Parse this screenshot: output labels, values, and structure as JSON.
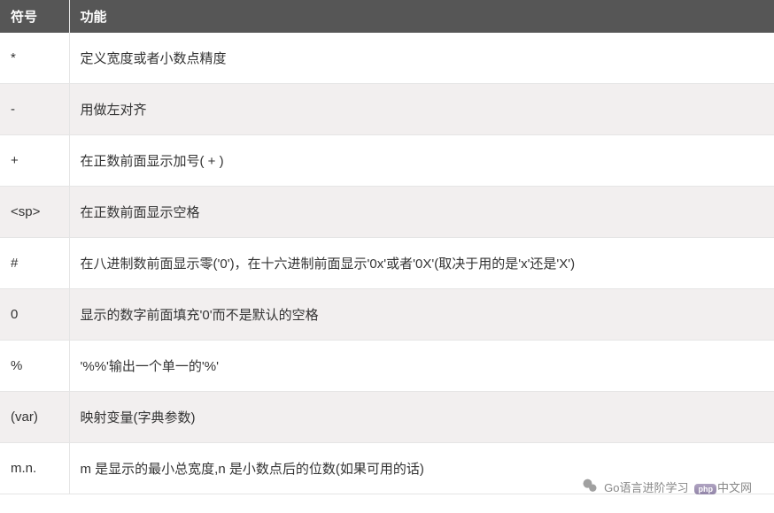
{
  "table": {
    "headers": {
      "symbol": "符号",
      "function": "功能"
    },
    "rows": [
      {
        "symbol": "*",
        "desc": "定义宽度或者小数点精度"
      },
      {
        "symbol": "-",
        "desc": "用做左对齐"
      },
      {
        "symbol": "+",
        "desc": "在正数前面显示加号( + )"
      },
      {
        "symbol": "<sp>",
        "desc": "在正数前面显示空格"
      },
      {
        "symbol": "#",
        "desc": "在八进制数前面显示零('0')，在十六进制前面显示'0x'或者'0X'(取决于用的是'x'还是'X')"
      },
      {
        "symbol": "0",
        "desc": "显示的数字前面填充'0'而不是默认的空格"
      },
      {
        "symbol": "%",
        "desc": "'%%'输出一个单一的'%'"
      },
      {
        "symbol": "(var)",
        "desc": "映射变量(字典参数)"
      },
      {
        "symbol": "m.n.",
        "desc": "m 是显示的最小总宽度,n 是小数点后的位数(如果可用的话)"
      }
    ]
  },
  "watermark": {
    "line1": "Go语言进阶学习",
    "php_label": "php",
    "suffix": "中文网"
  }
}
